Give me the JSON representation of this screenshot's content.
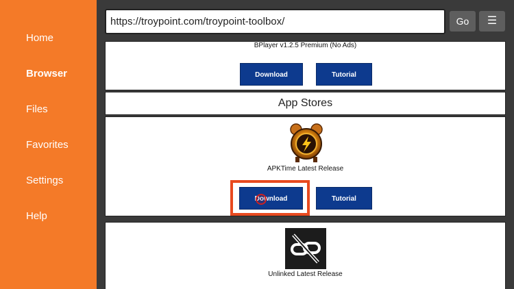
{
  "sidebar": {
    "items": [
      {
        "label": "Home"
      },
      {
        "label": "Browser"
      },
      {
        "label": "Files"
      },
      {
        "label": "Favorites"
      },
      {
        "label": "Settings"
      },
      {
        "label": "Help"
      }
    ],
    "active": "Browser"
  },
  "toolbar": {
    "url": "https://troypoint.com/troypoint-toolbox/",
    "go_label": "Go",
    "menu_label": "☰"
  },
  "content": {
    "bplayer": {
      "caption": "BPlayer v1.2.5 Premium (No Ads)",
      "download_label": "Download",
      "tutorial_label": "Tutorial"
    },
    "section_title": "App Stores",
    "apktime": {
      "icon": "apktime-clock-icon",
      "caption": "APKTime Latest Release",
      "download_label": "Download",
      "tutorial_label": "Tutorial"
    },
    "unlinked": {
      "icon": "unlinked-broken-link-icon",
      "caption": "Unlinked Latest Release"
    }
  },
  "colors": {
    "sidebar": "#f47a28",
    "button": "#0d3a8e",
    "highlight": "#e84a1f"
  }
}
